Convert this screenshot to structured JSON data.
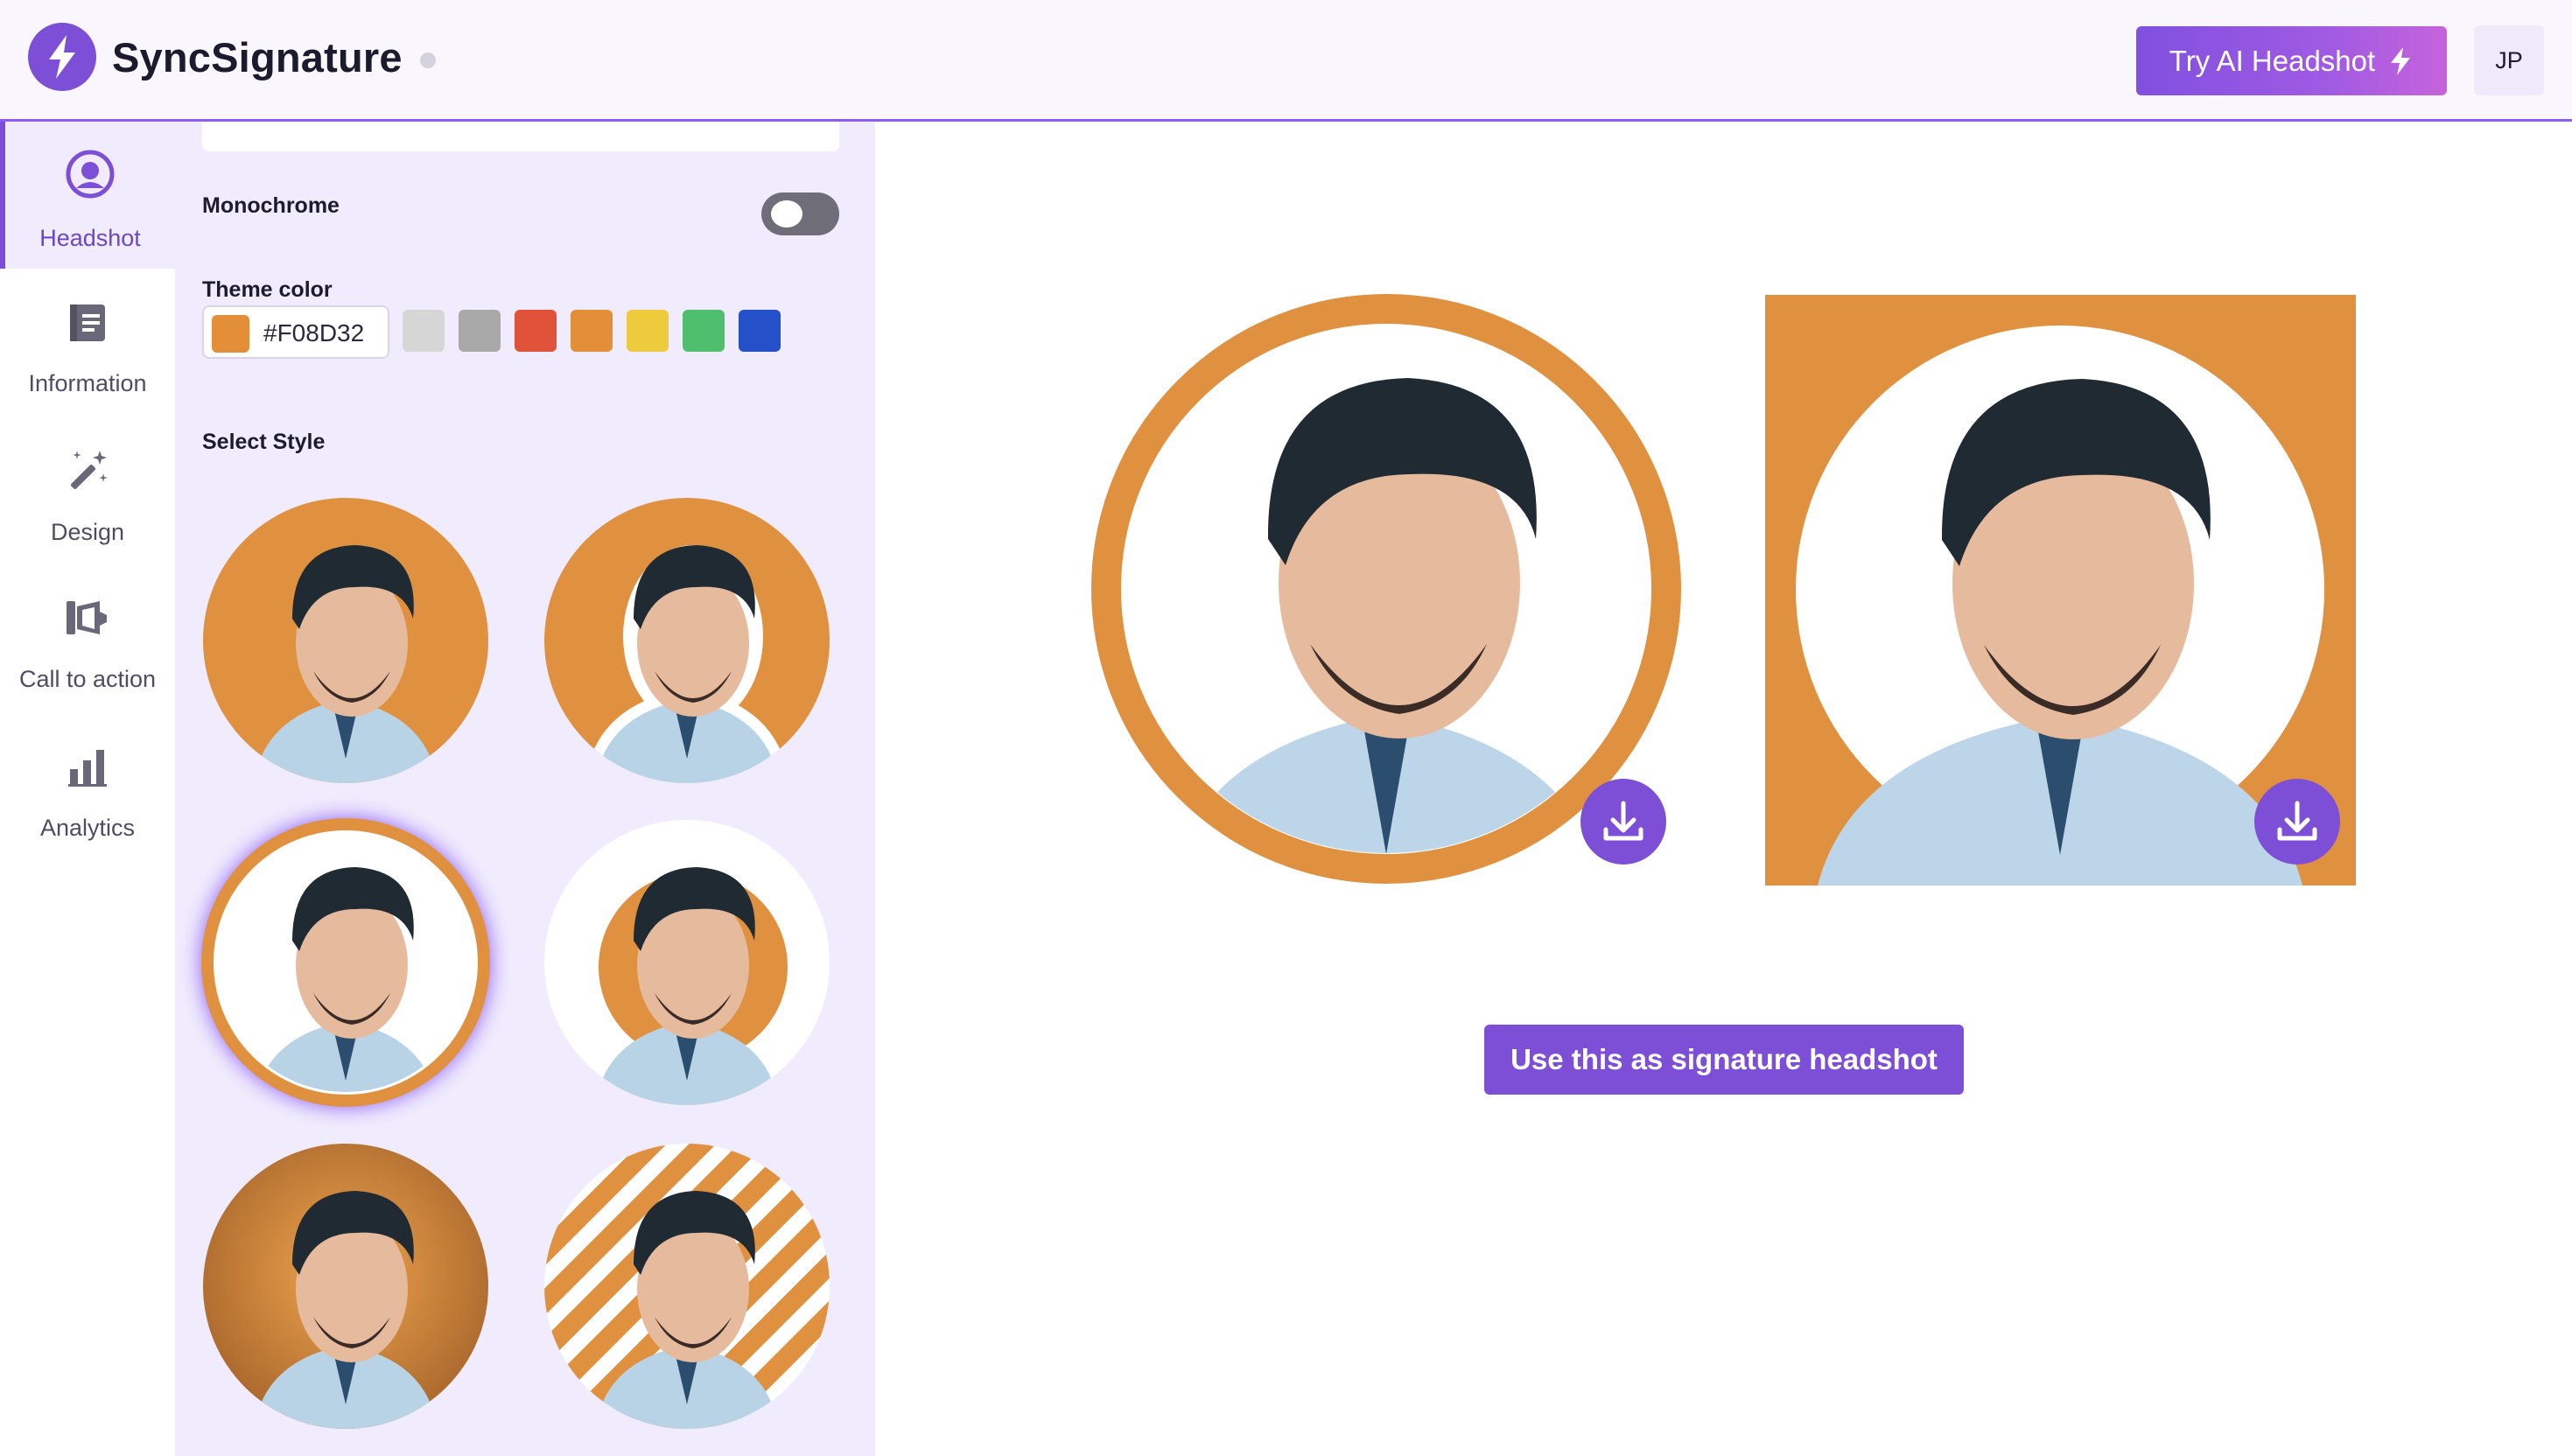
{
  "app": {
    "name": "SyncSignature",
    "cta_label": "Try AI Headshot",
    "cta_icon": "lightning-icon",
    "user_initials": "JP"
  },
  "nav": {
    "items": [
      {
        "label": "Headshot",
        "icon": "user-circle-icon",
        "active": true
      },
      {
        "label": "Information",
        "icon": "id-card-icon",
        "active": false
      },
      {
        "label": "Design",
        "icon": "magic-wand-icon",
        "active": false
      },
      {
        "label": "Call to action",
        "icon": "megaphone-icon",
        "active": false
      },
      {
        "label": "Analytics",
        "icon": "bar-chart-icon",
        "active": false
      }
    ]
  },
  "panel": {
    "monochrome_label": "Monochrome",
    "monochrome_on": false,
    "theme_color_label": "Theme color",
    "theme_color_value": "#F08D32",
    "preset_colors": [
      "#d6d6d6",
      "#a9a9a9",
      "#e0523a",
      "#e38f3a",
      "#eecb3c",
      "#4fbf6e",
      "#2450c9"
    ],
    "select_style_label": "Select Style",
    "styles": [
      {
        "name": "solid-circle",
        "selected": false
      },
      {
        "name": "outlined-cutout",
        "selected": false
      },
      {
        "name": "ring-border",
        "selected": true
      },
      {
        "name": "inner-circle",
        "selected": false
      },
      {
        "name": "gradient-circle",
        "selected": false
      },
      {
        "name": "striped-circle",
        "selected": false
      }
    ]
  },
  "preview": {
    "accent_color": "#E0913F",
    "download_icon": "download-icon",
    "use_button_label": "Use this as signature headshot"
  }
}
